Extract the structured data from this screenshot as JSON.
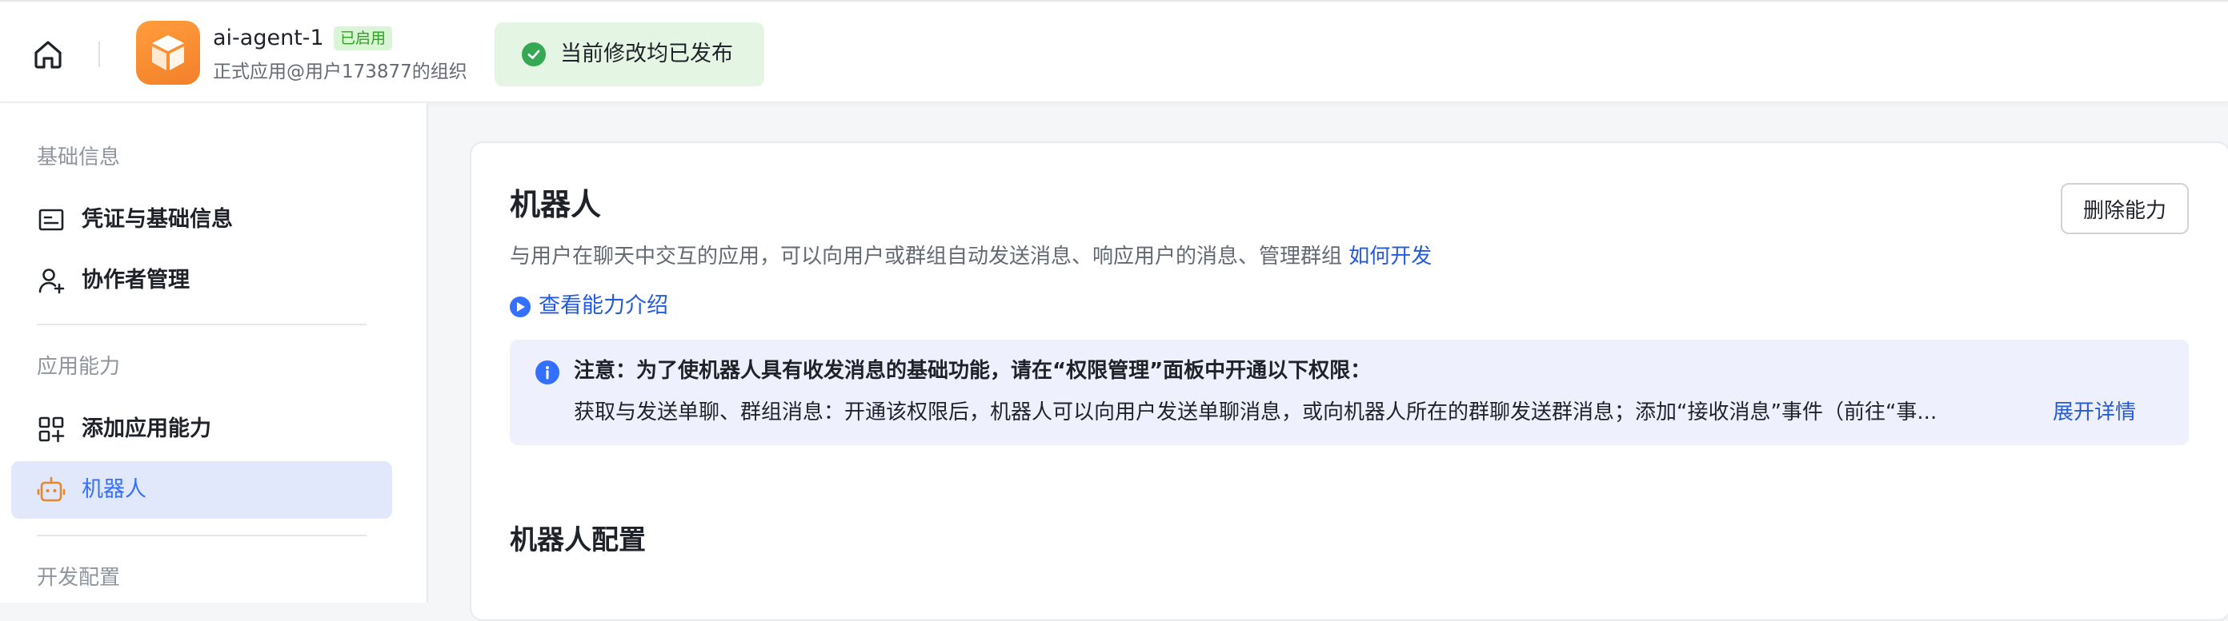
{
  "header": {
    "home_icon": "home-icon",
    "app_name": "ai-agent-1",
    "status_tag": "已启用",
    "app_subtitle": "正式应用@用户173877的组织",
    "publish_notice": "当前修改均已发布",
    "colors": {
      "logo": "#f3802a",
      "success": "#34a853",
      "banner_bg": "#e4f6e3"
    }
  },
  "sidebar": {
    "group_basic": "基础信息",
    "item_credentials": "凭证与基础信息",
    "item_collaborators": "协作者管理",
    "group_capabilities": "应用能力",
    "item_add_capability": "添加应用能力",
    "item_bot": "机器人",
    "group_dev": "开发配置",
    "active_item": "机器人",
    "colors": {
      "active_bg": "#e1e8fb",
      "active_text": "#3370ff"
    }
  },
  "main": {
    "title": "机器人",
    "description": "与用户在聊天中交互的应用，可以向用户或群组自动发送消息、响应用户的消息、管理群组",
    "how_to_link": "如何开发",
    "intro_link": "查看能力介绍",
    "delete_button": "删除能力",
    "notice": {
      "head": "注意：为了使机器人具有收发消息的基础功能，请在“权限管理”面板中开通以下权限：",
      "body": "获取与发送单聊、群组消息：开通该权限后，机器人可以向用户发送单聊消息，或向机器人所在的群聊发送群消息；添加“接收消息”事件（前往“事...",
      "expand_link": "展开详情"
    },
    "section_title": "机器人配置"
  }
}
